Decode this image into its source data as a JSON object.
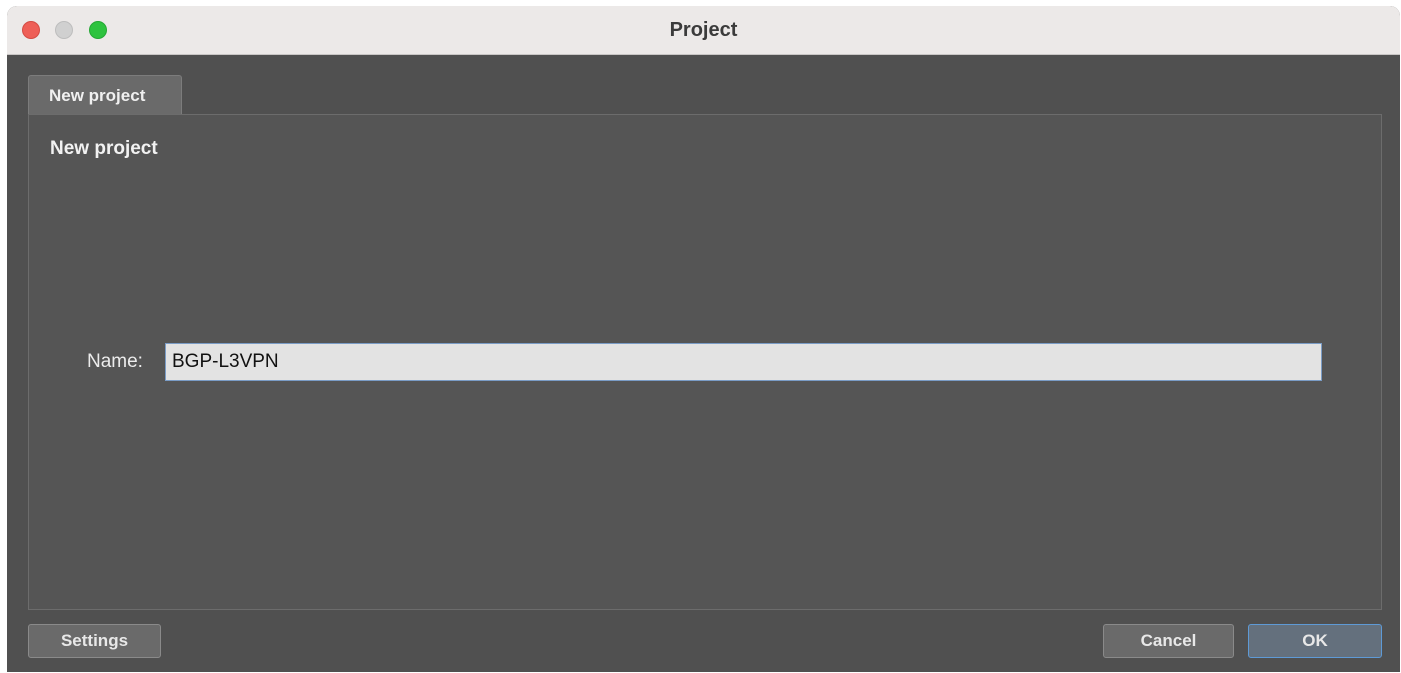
{
  "window": {
    "title": "Project"
  },
  "tabs": [
    {
      "label": "New project",
      "selected": true
    }
  ],
  "panel": {
    "heading": "New project",
    "name_label": "Name:",
    "name_value": "BGP-L3VPN"
  },
  "buttons": {
    "settings": "Settings",
    "cancel": "Cancel",
    "ok": "OK"
  },
  "colors": {
    "close": "#ee5f57",
    "minimize": "#d0d0d0",
    "maximize": "#2ec33f",
    "focus_ring": "#5e9ad6"
  }
}
